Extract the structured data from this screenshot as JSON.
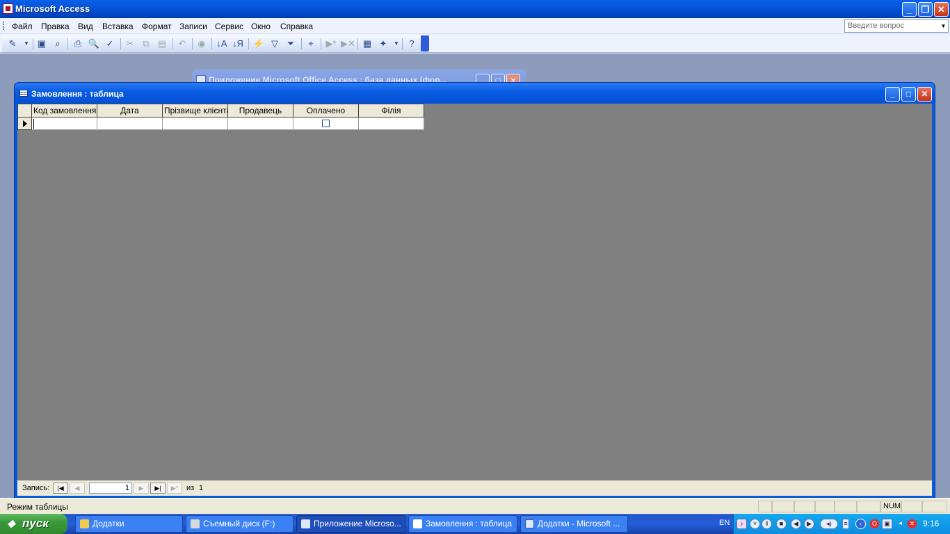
{
  "app": {
    "title": "Microsoft Access"
  },
  "menu": [
    "Файл",
    "Правка",
    "Вид",
    "Вставка",
    "Формат",
    "Записи",
    "Сервис",
    "Окно",
    "Справка"
  ],
  "ask": {
    "placeholder": "Введите вопрос"
  },
  "toolbar_icons": [
    "view-icon",
    "save-icon",
    "search-icon",
    "print-icon",
    "print-preview-icon",
    "spelling-icon",
    "cut-icon",
    "copy-icon",
    "paste-icon",
    "undo-icon",
    "hyperlink-icon",
    "sort-asc-icon",
    "sort-desc-icon",
    "filter-by-selection-icon",
    "filter-by-form-icon",
    "apply-filter-icon",
    "find-icon",
    "new-record-icon",
    "delete-record-icon",
    "database-window-icon",
    "new-object-icon",
    "help-icon"
  ],
  "bg_window": {
    "title": "Приложение Microsoft Office Access : база данных (фор..."
  },
  "table_window": {
    "title": "Замовлення : таблица",
    "columns": [
      "Код замовлення",
      "Дата",
      "Прізвище клієнта",
      "Продавець",
      "Оплачено",
      "Філія"
    ]
  },
  "navigator": {
    "label": "Запись:",
    "current": "1",
    "of_label": "из",
    "total": "1"
  },
  "status": {
    "text": "Режим таблицы",
    "num": "NUM"
  },
  "taskbar": {
    "start": "пуск",
    "tasks": [
      {
        "label": "Додатки",
        "icon": "folder-icon"
      },
      {
        "label": "Съемный диск (F:)",
        "icon": "drive-icon"
      },
      {
        "label": "Приложение Microso...",
        "icon": "access-icon",
        "active": true
      },
      {
        "label": "Замовлення : таблица",
        "icon": "table-icon"
      },
      {
        "label": "Додатки - Microsoft ...",
        "icon": "word-icon"
      }
    ],
    "lang": "EN",
    "clock": "9:16"
  },
  "colors": {
    "titlebar": "#0454d8",
    "mdi_bg": "#8e9cbb",
    "grid_bg": "#808080",
    "taskbar": "#245edb",
    "start": "#3c9a3c"
  }
}
